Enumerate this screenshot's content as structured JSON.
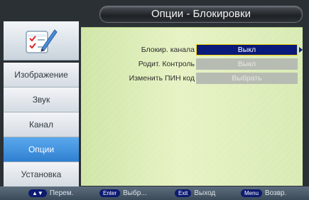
{
  "header": {
    "title": "Опции - Блокировки"
  },
  "sidebar": {
    "icon": "checklist-pencil-icon",
    "items": [
      {
        "label": "Изображение",
        "selected": false
      },
      {
        "label": "Звук",
        "selected": false
      },
      {
        "label": "Канал",
        "selected": false
      },
      {
        "label": "Опции",
        "selected": true
      },
      {
        "label": "Установка",
        "selected": false
      }
    ]
  },
  "settings": [
    {
      "label": "Блокир. канала",
      "value": "Выкл",
      "state": "active"
    },
    {
      "label": "Родит. Контроль",
      "value": "Выкл",
      "state": "disabled"
    },
    {
      "label": "Изменить ПИН код",
      "value": "Выбрать",
      "state": "disabled"
    }
  ],
  "footer": {
    "hints": [
      {
        "key": "▲▼",
        "text": "Перем."
      },
      {
        "key": "Enter",
        "text": "Выбр..."
      },
      {
        "key": "Exit",
        "text": "Выход"
      },
      {
        "key": "Menu",
        "text": "Возвр."
      }
    ]
  },
  "colors": {
    "selected_menu": "#3f92e0",
    "active_value": "#0a1a7a",
    "highlight_border": "#f2d000",
    "panel": "#dcedb8"
  }
}
